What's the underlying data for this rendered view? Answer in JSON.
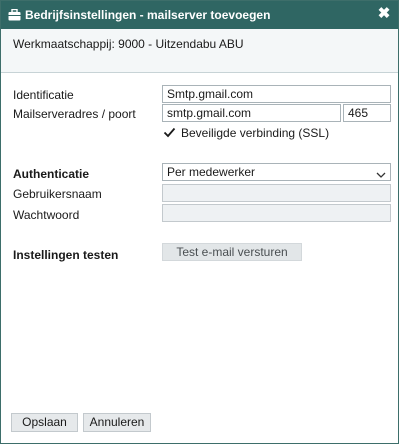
{
  "window": {
    "title": "Bedrijfsinstellingen - mailserver toevoegen",
    "close_glyph": "✖",
    "title_icon": "briefcase-icon"
  },
  "company": {
    "text": "Werkmaatschappij:  9000  -  Uitzendabu ABU"
  },
  "form": {
    "identificatie_label": "Identificatie",
    "identificatie_value": "Smtp.gmail.com",
    "mailserver_label": "Mailserveradres / poort",
    "mailserver_value": "smtp.gmail.com",
    "port_value": "465",
    "ssl_label": "Beveiligde verbinding (SSL)",
    "ssl_checked": true,
    "authenticatie_label": "Authenticatie",
    "authenticatie_value": "Per medewerker",
    "gebruikersnaam_label": "Gebruikersnaam",
    "gebruikersnaam_value": "",
    "wachtwoord_label": "Wachtwoord",
    "wachtwoord_value": "",
    "test_label": "Instellingen testen",
    "test_button": "Test e-mail versturen"
  },
  "footer": {
    "save_label": "Opslaan",
    "cancel_label": "Annuleren"
  },
  "colors": {
    "titlebar": "#2f6663",
    "company_bg": "#f4f7f8",
    "disabled_bg": "#eef1f3"
  }
}
